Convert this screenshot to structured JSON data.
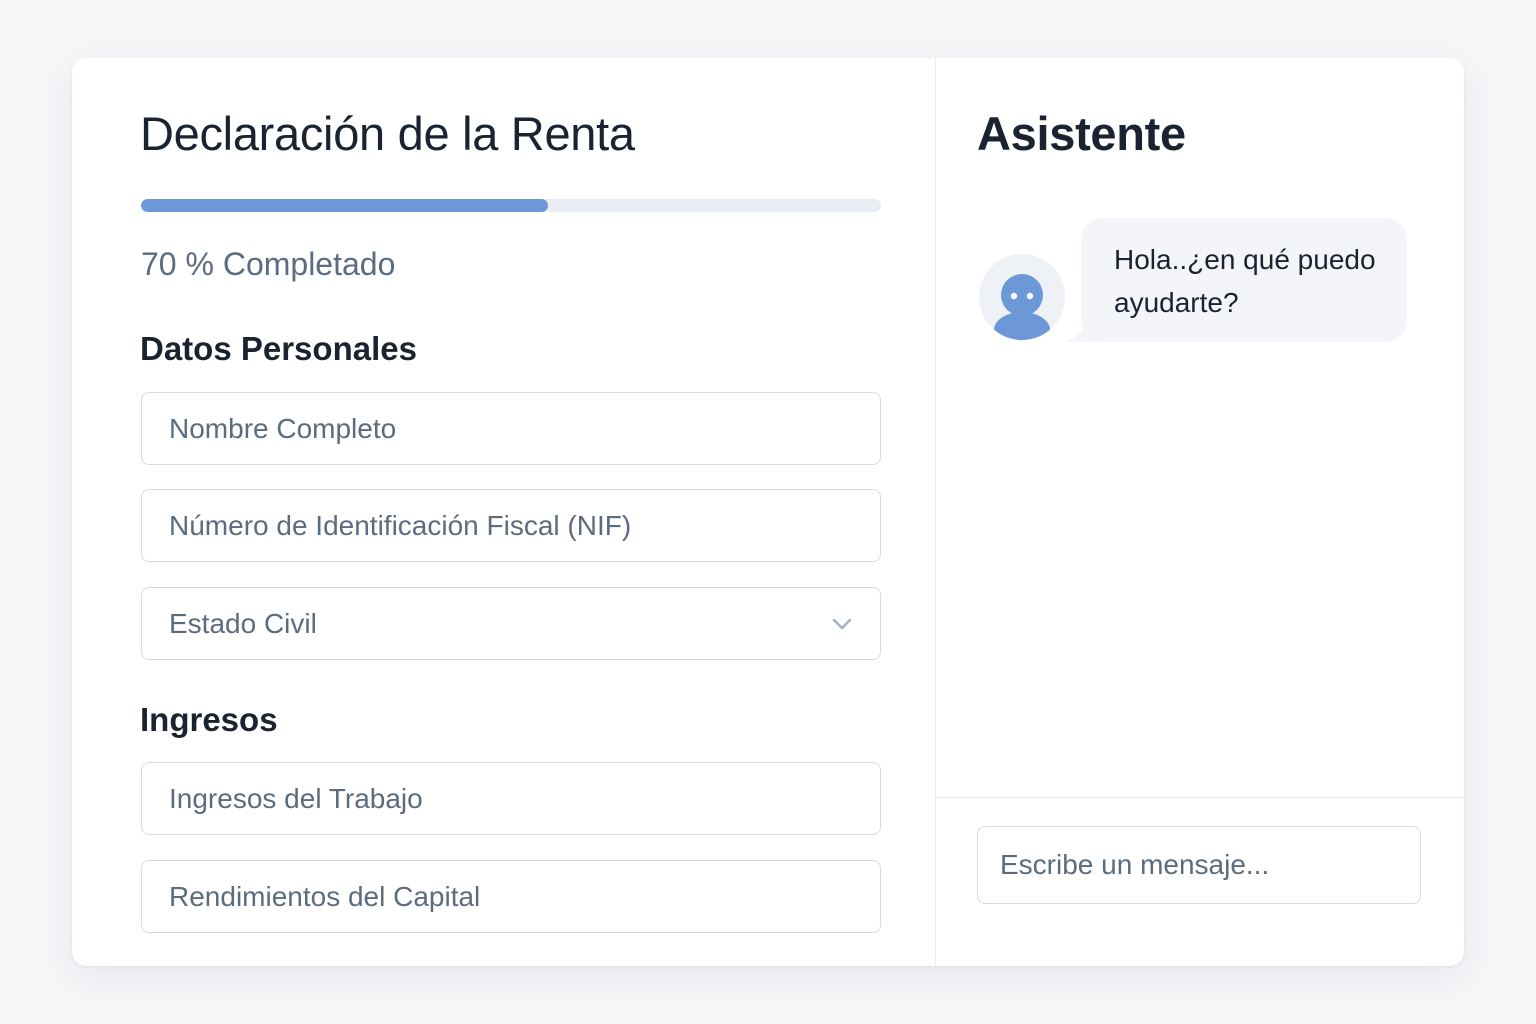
{
  "form": {
    "title": "Declaración de la Renta",
    "progress_percent": 55,
    "progress_text": "70 % Completado",
    "sections": {
      "personal": {
        "title": "Datos Personales",
        "full_name_placeholder": "Nombre Completo",
        "nif_placeholder": "Número de Identificación Fiscal (NIF)",
        "marital_status_label": "Estado Civil"
      },
      "income": {
        "title": "Ingresos",
        "work_income_placeholder": "Ingresos del Trabajo",
        "capital_income_placeholder": "Rendimientos del Capital"
      }
    }
  },
  "assistant": {
    "title": "Asistente",
    "avatar_icon": "bot-avatar-icon",
    "message_line1": "Hola..¿en qué puedo",
    "message_line2": "ayudarte?",
    "input_placeholder": "Escribe un mensaje..."
  },
  "colors": {
    "accent": "#6c98d8",
    "text": "#1b2330",
    "muted": "#5d6b80",
    "border": "#d5dce6"
  }
}
